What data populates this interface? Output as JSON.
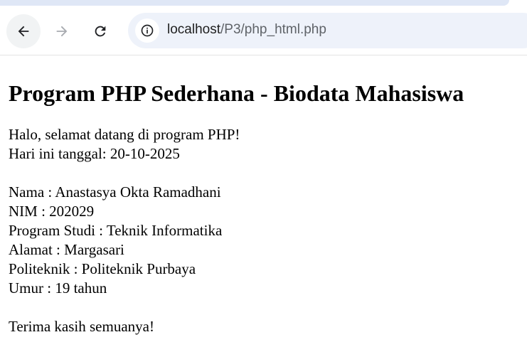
{
  "browser": {
    "url_host": "localhost",
    "url_path": "/P3/php_html.php"
  },
  "page": {
    "title": "Program PHP Sederhana - Biodata Mahasiswa",
    "greeting": "Halo, selamat datang di program PHP!",
    "date_line": "Hari ini tanggal: 20-10-2025",
    "biodata": [
      "Nama : Anastasya Okta Ramadhani",
      "NIM : 202029",
      "Program Studi : Teknik Informatika",
      "Alamat : Margasari",
      "Politeknik : Politeknik Purbaya",
      "Umur : 19 tahun"
    ],
    "closing": "Terima kasih semuanya!"
  }
}
